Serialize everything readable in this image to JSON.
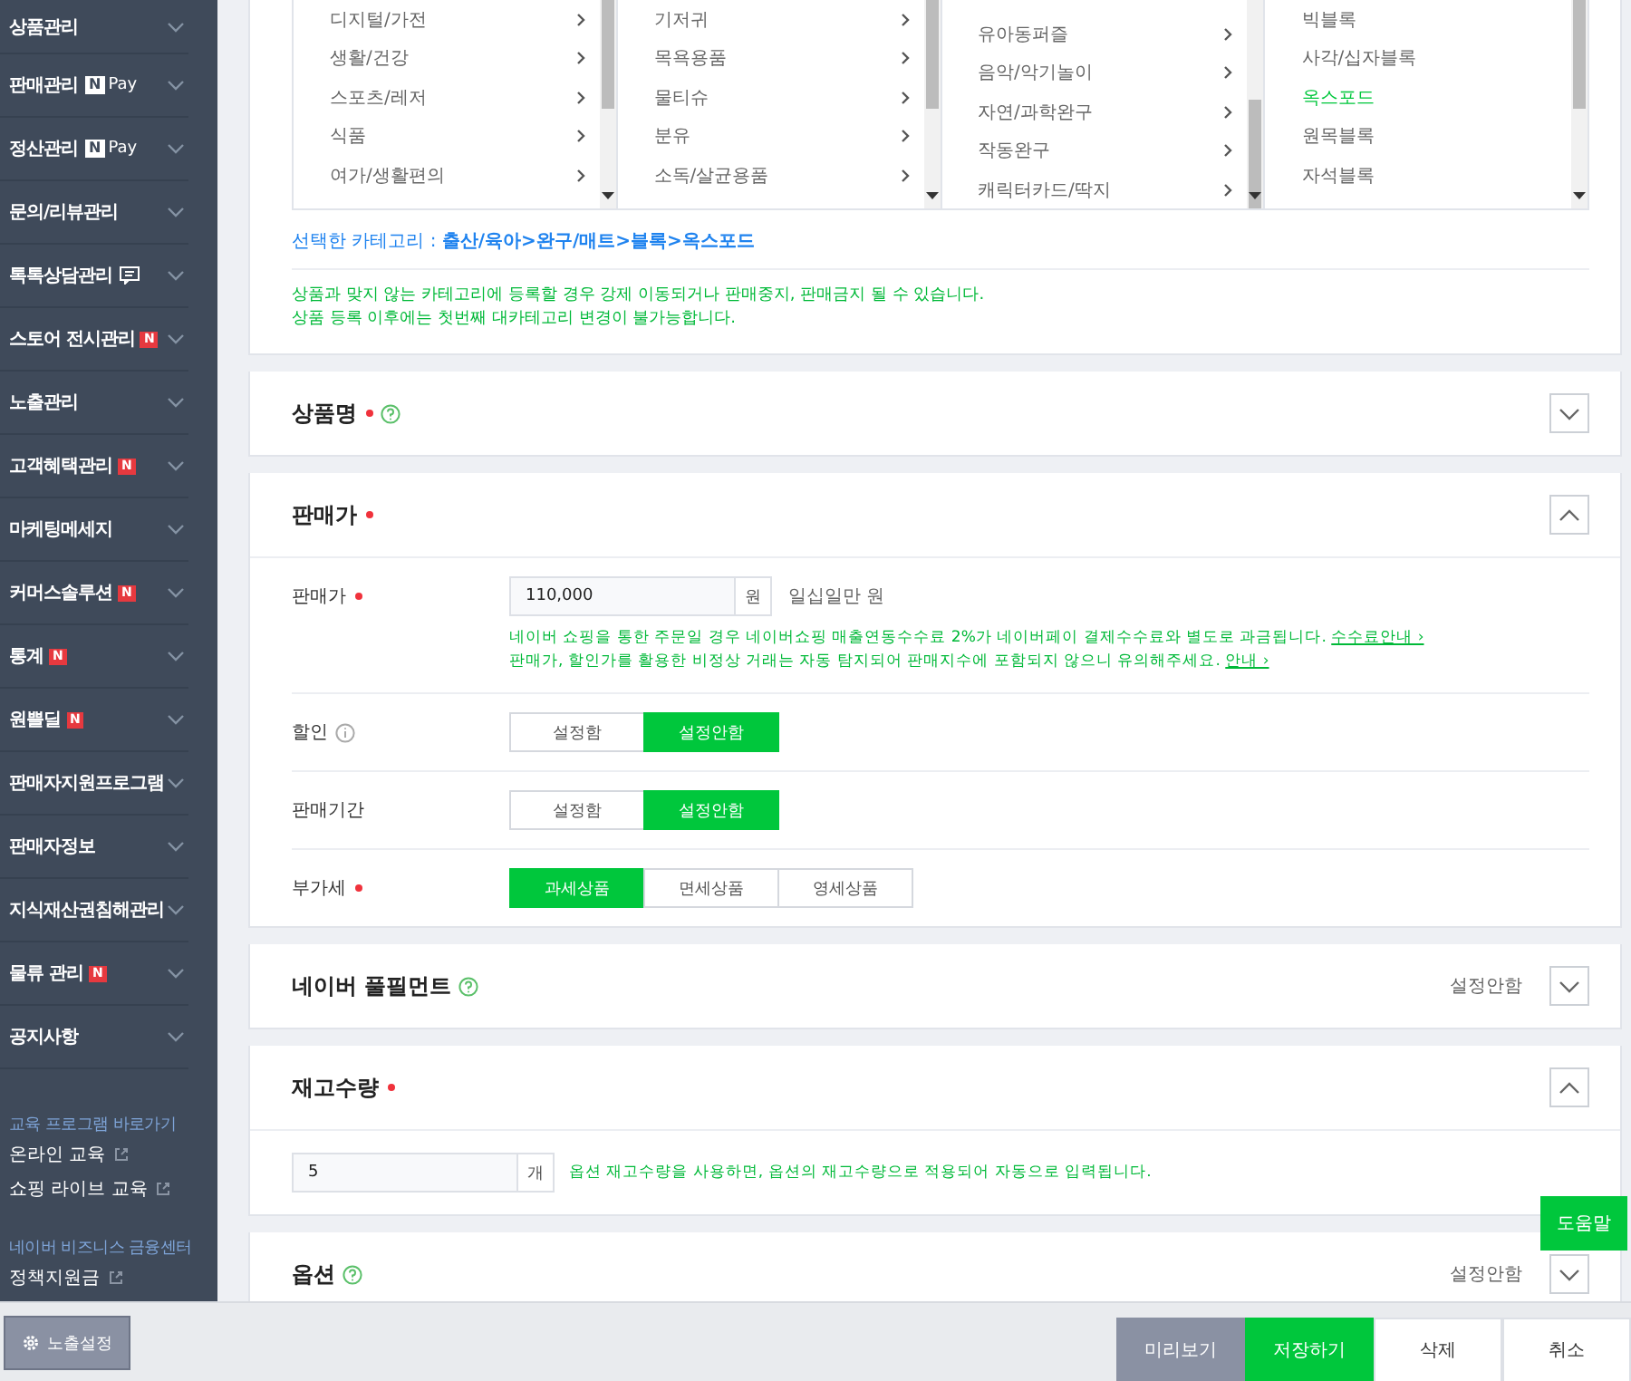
{
  "sidebar": {
    "items": [
      {
        "label": "상품관리"
      },
      {
        "label": "판매관리",
        "badge": {
          "kind": "npay",
          "mark": "N",
          "text": "Pay"
        }
      },
      {
        "label": "정산관리",
        "badge": {
          "kind": "npay",
          "mark": "N",
          "text": "Pay"
        }
      },
      {
        "label": "문의/리뷰관리"
      },
      {
        "label": "톡톡상담관리",
        "badge": {
          "kind": "talk"
        }
      },
      {
        "label": "스토어 전시관리",
        "badge": {
          "kind": "new",
          "mark": "N"
        }
      },
      {
        "label": "노출관리"
      },
      {
        "label": "고객혜택관리",
        "badge": {
          "kind": "new",
          "mark": "N"
        }
      },
      {
        "label": "마케팅메세지"
      },
      {
        "label": "커머스솔루션",
        "badge": {
          "kind": "new",
          "mark": "N"
        }
      },
      {
        "label": "통계",
        "badge": {
          "kind": "new",
          "mark": "N"
        }
      },
      {
        "label": "원쁠딜",
        "badge": {
          "kind": "new",
          "mark": "N"
        }
      },
      {
        "label": "판매자지원프로그램"
      },
      {
        "label": "판매자정보"
      },
      {
        "label": "지식재산권침해관리"
      },
      {
        "label": "물류 관리",
        "badge": {
          "kind": "new",
          "mark": "N"
        }
      },
      {
        "label": "공지사항"
      }
    ],
    "links": [
      {
        "kind": "heading",
        "label": "교육 프로그램 바로가기"
      },
      {
        "kind": "link",
        "label": "온라인 교육"
      },
      {
        "kind": "link",
        "label": "쇼핑 라이브 교육"
      },
      {
        "kind": "heading",
        "label": "네이버 비즈니스 금융센터"
      },
      {
        "kind": "link",
        "label": "정책지원금"
      }
    ]
  },
  "category": {
    "columns": [
      {
        "items": [
          {
            "label": "디지털/가전",
            "selected": false
          },
          {
            "label": "생활/건강",
            "selected": false
          },
          {
            "label": "스포츠/레저",
            "selected": false
          },
          {
            "label": "식품",
            "selected": false
          },
          {
            "label": "여가/생활편의",
            "selected": false
          }
        ]
      },
      {
        "items": [
          {
            "label": "기저귀",
            "selected": false
          },
          {
            "label": "목욕용품",
            "selected": false
          },
          {
            "label": "물티슈",
            "selected": false
          },
          {
            "label": "분유",
            "selected": false
          },
          {
            "label": "소독/살균용품",
            "selected": false
          }
        ]
      },
      {
        "items": [
          {
            "label": "유아동퍼즐",
            "selected": false
          },
          {
            "label": "음악/악기놀이",
            "selected": false
          },
          {
            "label": "자연/과학완구",
            "selected": false
          },
          {
            "label": "작동완구",
            "selected": false
          },
          {
            "label": "캐릭터카드/딱지",
            "selected": false
          }
        ]
      },
      {
        "leaf": true,
        "items": [
          {
            "label": "빅블록",
            "selected": false
          },
          {
            "label": "사각/십자블록",
            "selected": false
          },
          {
            "label": "옥스포드",
            "selected": true
          },
          {
            "label": "원목블록",
            "selected": false
          },
          {
            "label": "자석블록",
            "selected": false
          }
        ]
      }
    ],
    "selected_text": "선택한 카테고리 : **출산/육아>완구/매트>블록>옥스포드**",
    "notes": [
      "상품과 맞지 않는 카테고리에 등록할 경우 강제 이동되거나 판매중지, 판매금지 될 수 있습니다.",
      "상품 등록 이후에는 첫번째 대카테고리 변경이 불가능합니다."
    ]
  },
  "sections": [
    {
      "title": "상품명",
      "required": true,
      "help": true,
      "expanded": false
    },
    {
      "title": "판매가",
      "required": true,
      "expanded": true,
      "rows": [
        {
          "kind": "price",
          "label": "판매가",
          "required": true,
          "value": "110,000",
          "unit": "원",
          "reading": "일십일만 원",
          "notes": [
            {
              "text": "네이버 쇼핑을 통한 주문일 경우 네이버쇼핑 매출연동수수료 2%가 네이버페이 결제수수료와 별도로 과금됩니다.",
              "link": "수수료안내 ›"
            },
            {
              "text": "판매가, 할인가를 활용한 비정상 거래는 자동 탐지되어 판매지수에 포함되지 않으니 유의해주세요.",
              "link": "안내 ›"
            }
          ]
        },
        {
          "kind": "toggle",
          "label": "할인",
          "info": true,
          "options": [
            {
              "label": "설정함",
              "selected": false
            },
            {
              "label": "설정안함",
              "selected": true
            }
          ]
        },
        {
          "kind": "toggle",
          "label": "판매기간",
          "options": [
            {
              "label": "설정함",
              "selected": false
            },
            {
              "label": "설정안함",
              "selected": true
            }
          ]
        },
        {
          "kind": "toggle",
          "label": "부가세",
          "required": true,
          "options": [
            {
              "label": "과세상품",
              "selected": true
            },
            {
              "label": "면세상품",
              "selected": false
            },
            {
              "label": "영세상품",
              "selected": false
            }
          ]
        }
      ]
    },
    {
      "title": "네이버 풀필먼트",
      "help": true,
      "status": "설정안함",
      "expanded": false
    },
    {
      "title": "재고수량",
      "required": true,
      "expanded": true,
      "rows": [
        {
          "kind": "stock",
          "value": "5",
          "unit": "개",
          "note": "옵션 재고수량을 사용하면, 옵션의 재고수량으로 적용되어 자동으로 입력됩니다."
        }
      ]
    },
    {
      "title": "옵션",
      "help": true,
      "status": "설정안함",
      "expanded": false
    }
  ],
  "help_button": "도움말",
  "footer": {
    "left": "노출설정",
    "buttons": [
      {
        "label": "미리보기",
        "kind": "preview"
      },
      {
        "label": "저장하기",
        "kind": "primary"
      },
      {
        "label": "삭제",
        "kind": "plain"
      },
      {
        "label": "취소",
        "kind": "plain"
      }
    ]
  }
}
